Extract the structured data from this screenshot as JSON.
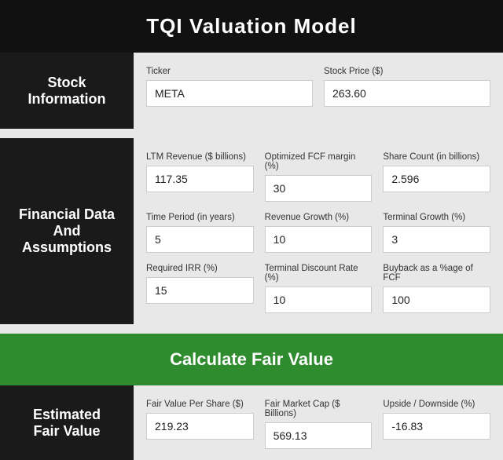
{
  "header": {
    "title": "TQI Valuation Model"
  },
  "stock_section": {
    "label": "Stock\nInformation",
    "ticker_label": "Ticker",
    "ticker_value": "META",
    "price_label": "Stock Price ($)",
    "price_value": "263.60"
  },
  "financial_section": {
    "label": "Financial Data\nAnd\nAssumptions",
    "row1": [
      {
        "label": "LTM Revenue ($ billions)",
        "value": "117.35"
      },
      {
        "label": "Optimized FCF margin (%)",
        "value": "30"
      },
      {
        "label": "Share Count (in billions)",
        "value": "2.596"
      }
    ],
    "row2": [
      {
        "label": "Time Period (in years)",
        "value": "5"
      },
      {
        "label": "Revenue Growth (%)",
        "value": "10"
      },
      {
        "label": "Terminal Growth (%)",
        "value": "3"
      }
    ],
    "row3": [
      {
        "label": "Required IRR (%)",
        "value": "15"
      },
      {
        "label": "Terminal Discount Rate (%)",
        "value": "10"
      },
      {
        "label": "Buyback as a %age of FCF",
        "value": "100"
      }
    ]
  },
  "calculate_btn": {
    "label": "Calculate Fair Value"
  },
  "results_section": {
    "label": "Estimated\nFair Value",
    "fields": [
      {
        "label": "Fair Value Per Share ($)",
        "value": "219.23"
      },
      {
        "label": "Fair Market Cap ($ Billions)",
        "value": "569.13"
      },
      {
        "label": "Upside / Downside (%)",
        "value": "-16.83"
      }
    ]
  }
}
